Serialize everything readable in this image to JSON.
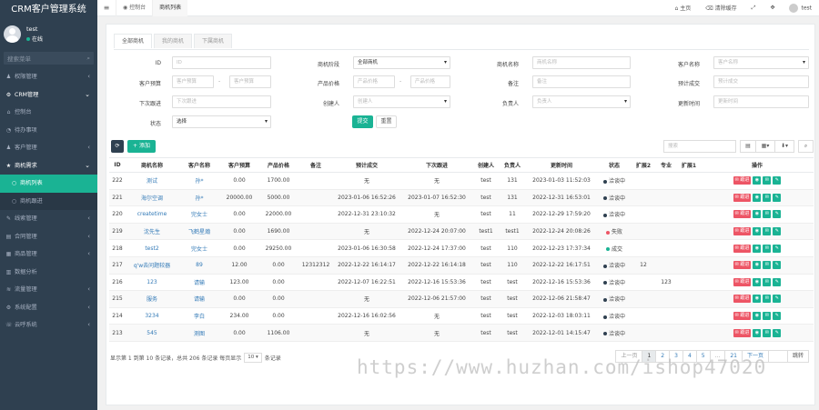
{
  "app": {
    "title": "CRM客户管理系统"
  },
  "user": {
    "name": "test",
    "status": "在线"
  },
  "sidebar": {
    "search_placeholder": "搜索菜单",
    "items": [
      {
        "label": "权限管理",
        "icon": "user-icon"
      },
      {
        "label": "CRM管理",
        "icon": "gear-icon"
      },
      {
        "label": "控制台",
        "icon": "home-icon"
      },
      {
        "label": "待办事项",
        "icon": "bell-icon"
      },
      {
        "label": "客户管理",
        "icon": "user-icon"
      },
      {
        "label": "商机需求",
        "icon": "star-icon"
      },
      {
        "label": "商机列表",
        "icon": "circle-icon"
      },
      {
        "label": "商机跟进",
        "icon": "circle-icon"
      },
      {
        "label": "线索管理",
        "icon": "bulb-icon"
      },
      {
        "label": "合同管理",
        "icon": "file-icon"
      },
      {
        "label": "商品管理",
        "icon": "box-icon"
      },
      {
        "label": "数据分析",
        "icon": "chart-icon"
      },
      {
        "label": "流量管理",
        "icon": "flow-icon"
      },
      {
        "label": "系统配置",
        "icon": "gear-icon"
      },
      {
        "label": "云呼系统",
        "icon": "phone-icon"
      }
    ]
  },
  "topbar": {
    "tabs": [
      "控制台",
      "商机列表"
    ],
    "home": "主页",
    "clear_cache": "清除缓存",
    "user": "test"
  },
  "subtabs": [
    "全部商机",
    "我的商机",
    "下属商机"
  ],
  "filters": {
    "id_label": "ID",
    "id_placeholder": "ID",
    "stage_label": "商机阶段",
    "stage_value": "全部商机",
    "name_label": "商机名称",
    "name_placeholder": "商机名称",
    "customer_label": "客户名称",
    "customer_placeholder": "客户名称",
    "budget_label": "客户预算",
    "budget_min_placeholder": "客户预算",
    "budget_max_placeholder": "客户预算",
    "price_label": "产品价格",
    "price_min_placeholder": "产品价格",
    "price_max_placeholder": "产品价格",
    "remark_label": "备注",
    "remark_placeholder": "备注",
    "expected_label": "预计成交",
    "expected_placeholder": "预计成交",
    "next_label": "下次跟进",
    "next_placeholder": "下次跟进",
    "creator_label": "创建人",
    "creator_placeholder": "创建人",
    "owner_label": "负责人",
    "owner_placeholder": "负责人",
    "update_label": "更新时间",
    "update_placeholder": "更新时间",
    "status_label": "状态",
    "status_value": "选择",
    "submit": "提交",
    "reset": "重置"
  },
  "toolbar": {
    "add": "添加",
    "search_placeholder": "搜索"
  },
  "table": {
    "headers": [
      "ID",
      "商机名称",
      "客户名称",
      "客户预算",
      "产品价格",
      "备注",
      "预计成交",
      "下次跟进",
      "创建人",
      "负责人",
      "更新时间",
      "状态",
      "扩展2",
      "专业",
      "扩展1",
      "操作"
    ],
    "rows": [
      [
        "222",
        "测试",
        "孙*",
        "0.00",
        "1700.00",
        "",
        "无",
        "无",
        "test",
        "131",
        "2023-01-03 11:52:03",
        "洽谈中",
        "",
        "",
        ""
      ],
      [
        "221",
        "海尔空调",
        "孙*",
        "20000.00",
        "5000.00",
        "",
        "2023-01-06 16:52:26",
        "2023-01-07 16:52:30",
        "test",
        "131",
        "2022-12-31 16:53:01",
        "洽谈中",
        "",
        "",
        ""
      ],
      [
        "220",
        "createtime",
        "完女士",
        "0.00",
        "22000.00",
        "",
        "2022-12-31 23:10:32",
        "无",
        "test",
        "11",
        "2022-12-29 17:59:20",
        "洽谈中",
        "",
        "",
        ""
      ],
      [
        "219",
        "沈先生",
        "飞鹤星瀚",
        "0.00",
        "1690.00",
        "",
        "无",
        "2022-12-24 20:07:00",
        "test1",
        "test1",
        "2022-12-24 20:08:26",
        "失败",
        "",
        "",
        ""
      ],
      [
        "218",
        "test2",
        "完女士",
        "0.00",
        "29250.00",
        "",
        "2023-01-06 16:30:58",
        "2022-12-24 17:37:00",
        "test",
        "110",
        "2022-12-23 17:37:34",
        "成交",
        "",
        "",
        ""
      ],
      [
        "217",
        "q'w去问题较器",
        "89",
        "12.00",
        "0.00",
        "12312312",
        "2022-12-22 16:14:17",
        "2022-12-22 16:14:18",
        "test",
        "110",
        "2022-12-22 16:17:51",
        "洽谈中",
        "12",
        "",
        ""
      ],
      [
        "216",
        "123",
        "请输",
        "123.00",
        "0.00",
        "",
        "2022-12-07 16:22:51",
        "2022-12-16 15:53:36",
        "test",
        "test",
        "2022-12-16 15:53:36",
        "洽谈中",
        "",
        "123",
        ""
      ],
      [
        "215",
        "服务",
        "请输",
        "0.00",
        "0.00",
        "",
        "无",
        "2022-12-06 21:57:00",
        "test",
        "test",
        "2022-12-06 21:58:47",
        "洽谈中",
        "",
        "",
        ""
      ],
      [
        "214",
        "3234",
        "李白",
        "234.00",
        "0.00",
        "",
        "2022-12-16 16:02:56",
        "无",
        "test",
        "test",
        "2022-12-03 18:03:11",
        "洽谈中",
        "",
        "",
        ""
      ],
      [
        "213",
        "545",
        "测图",
        "0.00",
        "1106.00",
        "",
        "无",
        "无",
        "test",
        "test",
        "2022-12-01 14:15:47",
        "洽谈中",
        "",
        "",
        ""
      ]
    ],
    "op_follow": "跟进"
  },
  "status_colors": {
    "洽谈中": "#2f4050",
    "失败": "#ed5565",
    "成交": "#1ab394"
  },
  "pagination": {
    "info_prefix": "显示第 1 到第 10 条记录，总共 206 条记录 每页显示",
    "page_size": "10",
    "info_suffix": "条记录",
    "prev": "上一页",
    "pages": [
      "1",
      "2",
      "3",
      "4",
      "5",
      "...",
      "21"
    ],
    "next": "下一页",
    "jump": "跳转"
  },
  "watermark": "https://www.huzhan.com/ishop47020"
}
